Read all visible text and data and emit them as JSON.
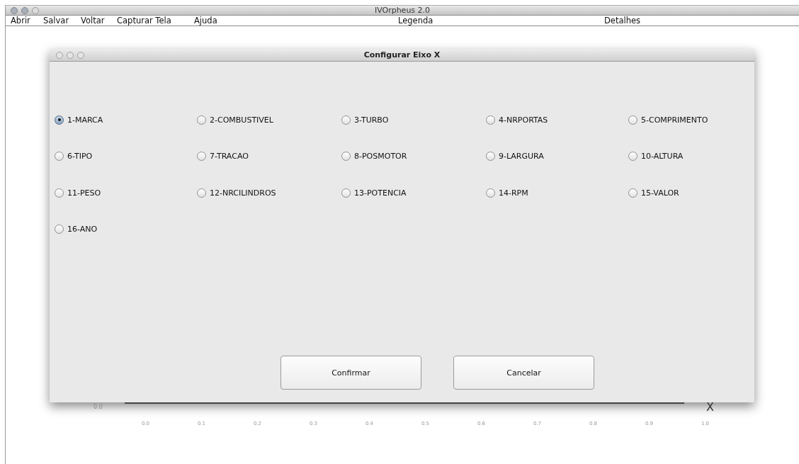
{
  "window": {
    "title": "IVOrpheus 2.0"
  },
  "menu": [
    "Abrir",
    "Salvar",
    "Voltar",
    "Capturar Tela",
    "Ajuda",
    "Legenda",
    "Detalhes"
  ],
  "background_chart": {
    "y_tick": "0.0",
    "x_ticks": [
      "0.0",
      "0.1",
      "0.2",
      "0.3",
      "0.4",
      "0.5",
      "0.6",
      "0.7",
      "0.8",
      "0.9",
      "1.0"
    ],
    "axis_label": "X"
  },
  "dialog": {
    "title": "Configurar Eixo X",
    "options": [
      {
        "label": "1-MARCA",
        "selected": true
      },
      {
        "label": "2-COMBUSTIVEL",
        "selected": false
      },
      {
        "label": "3-TURBO",
        "selected": false
      },
      {
        "label": "4-NRPORTAS",
        "selected": false
      },
      {
        "label": "5-COMPRIMENTO",
        "selected": false
      },
      {
        "label": "6-TIPO",
        "selected": false
      },
      {
        "label": "7-TRACAO",
        "selected": false
      },
      {
        "label": "8-POSMOTOR",
        "selected": false
      },
      {
        "label": "9-LARGURA",
        "selected": false
      },
      {
        "label": "10-ALTURA",
        "selected": false
      },
      {
        "label": "11-PESO",
        "selected": false
      },
      {
        "label": "12-NRCILINDROS",
        "selected": false
      },
      {
        "label": "13-POTENCIA",
        "selected": false
      },
      {
        "label": "14-RPM",
        "selected": false
      },
      {
        "label": "15-VALOR",
        "selected": false
      },
      {
        "label": "16-ANO",
        "selected": false
      }
    ],
    "buttons": [
      "Confirmar",
      "Cancelar"
    ]
  }
}
